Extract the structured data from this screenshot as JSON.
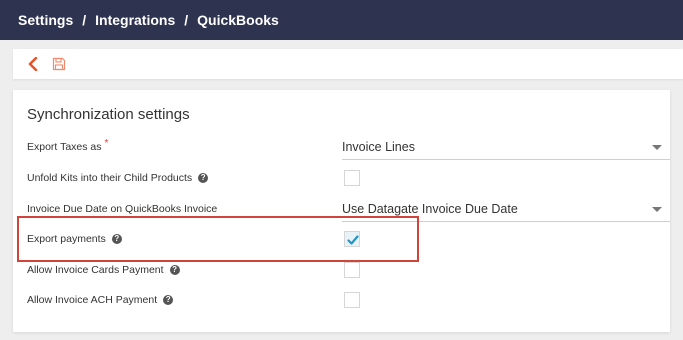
{
  "breadcrumb": [
    "Settings",
    "Integrations",
    "QuickBooks"
  ],
  "breadcrumb_separator": "/",
  "toolbar": {
    "back_icon": "chevron-left-icon",
    "save_icon": "save-icon",
    "accent": "#e8542c"
  },
  "section": {
    "title": "Synchronization settings",
    "rows": [
      {
        "label": "Export Taxes as",
        "required": "*",
        "control": "select",
        "value": "Invoice Lines"
      },
      {
        "label": "Unfold Kits into their Child Products",
        "help": "?",
        "control": "checkbox",
        "checked": false
      },
      {
        "label": "Invoice Due Date on QuickBooks Invoice",
        "control": "select",
        "value": "Use Datagate Invoice Due Date"
      },
      {
        "label": "Export payments",
        "help": "?",
        "control": "checkbox",
        "checked": true
      },
      {
        "label": "Allow Invoice Cards Payment",
        "help": "?",
        "control": "checkbox",
        "checked": false
      },
      {
        "label": "Allow Invoice ACH Payment",
        "help": "?",
        "control": "checkbox",
        "checked": false
      }
    ]
  },
  "colors": {
    "header_bg": "#2e3450",
    "highlight_border": "#d0443a",
    "check_color": "#2196c4",
    "required": "#e03c2f"
  }
}
